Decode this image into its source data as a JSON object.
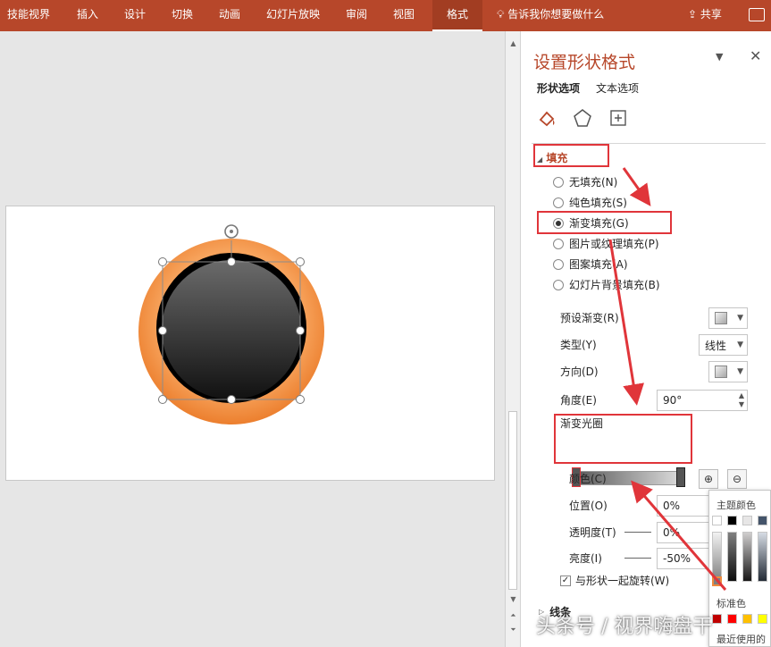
{
  "ribbon": {
    "tabs": [
      "技能视界",
      "插入",
      "设计",
      "切换",
      "动画",
      "幻灯片放映",
      "审阅",
      "视图"
    ],
    "active_tab": "格式",
    "tell_me": "告诉我你想要做什么",
    "share": "共享"
  },
  "pane": {
    "title": "设置形状格式",
    "tabs": [
      "形状选项",
      "文本选项"
    ],
    "fill_section": "填充",
    "fill_options": [
      "无填充(N)",
      "纯色填充(S)",
      "渐变填充(G)",
      "图片或纹理填充(P)",
      "图案填充(A)",
      "幻灯片背景填充(B)"
    ],
    "selected_fill": "渐变填充(G)",
    "preset_label": "预设渐变(R)",
    "type_label": "类型(Y)",
    "type_value": "线性",
    "direction_label": "方向(D)",
    "angle_label": "角度(E)",
    "angle_value": "90°",
    "stops_label": "渐变光圈",
    "color_label": "颜色(C)",
    "position_label": "位置(O)",
    "position_value": "0%",
    "transparency_label": "透明度(T)",
    "transparency_value": "0%",
    "brightness_label": "亮度(I)",
    "brightness_value": "-50%",
    "rotate_label": "与形状一起旋转(W)",
    "line_section": "线条"
  },
  "color_popup": {
    "theme_colors": "主题颜色",
    "standard_colors": "标准色",
    "recent": "最近使用的"
  },
  "watermark": "头条号 / 视界嗨盘干",
  "colors": {
    "accent": "#b7472a",
    "orange": "#f08a3c",
    "highlight": "#e0353a"
  }
}
